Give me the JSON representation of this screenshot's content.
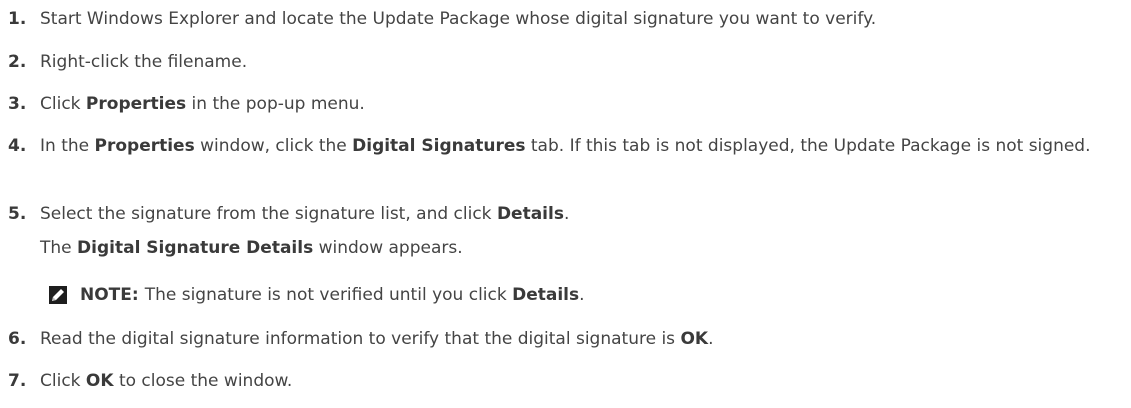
{
  "steps": [
    {
      "number": "1.",
      "parts": [
        {
          "text": "Start Windows Explorer and locate the Update Package whose digital signature you want to verify.",
          "bold": false
        }
      ]
    },
    {
      "number": "2.",
      "parts": [
        {
          "text": "Right-click the filename.",
          "bold": false
        }
      ]
    },
    {
      "number": "3.",
      "parts": [
        {
          "text": "Click ",
          "bold": false
        },
        {
          "text": "Properties",
          "bold": true
        },
        {
          "text": " in the pop-up menu.",
          "bold": false
        }
      ]
    },
    {
      "number": "4.",
      "parts": [
        {
          "text": "In the ",
          "bold": false
        },
        {
          "text": "Properties",
          "bold": true
        },
        {
          "text": " window, click the ",
          "bold": false
        },
        {
          "text": "Digital Signatures",
          "bold": true
        },
        {
          "text": " tab. If this tab is not displayed, the Update Package is not signed.",
          "bold": false
        }
      ]
    },
    {
      "number": "5.",
      "parts": [
        {
          "text": "Select the signature from the signature list, and click ",
          "bold": false
        },
        {
          "text": "Details",
          "bold": true
        },
        {
          "text": ".",
          "bold": false
        }
      ],
      "result_parts": [
        {
          "text": "The ",
          "bold": false
        },
        {
          "text": "Digital Signature Details",
          "bold": true
        },
        {
          "text": " window appears.",
          "bold": false
        }
      ],
      "note": {
        "icon": "pencil-note-icon",
        "label": "NOTE:",
        "parts": [
          {
            "text": "The signature is not verified until you click ",
            "bold": false
          },
          {
            "text": "Details",
            "bold": true
          },
          {
            "text": ".",
            "bold": false
          }
        ]
      }
    },
    {
      "number": "6.",
      "parts": [
        {
          "text": "Read the digital signature information to verify that the digital signature is ",
          "bold": false
        },
        {
          "text": "OK",
          "bold": true
        },
        {
          "text": ".",
          "bold": false
        }
      ]
    },
    {
      "number": "7.",
      "parts": [
        {
          "text": "Click ",
          "bold": false
        },
        {
          "text": "OK",
          "bold": true
        },
        {
          "text": " to close the window.",
          "bold": false
        }
      ]
    }
  ]
}
